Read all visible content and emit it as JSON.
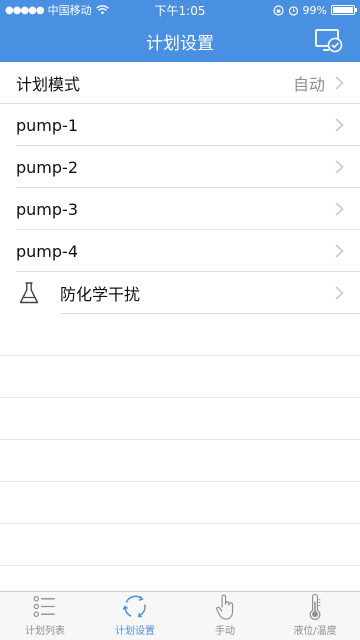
{
  "status_bar": {
    "carrier": "中国移动",
    "time": "下午1:05",
    "battery": "99%",
    "battery_level": 0.99
  },
  "nav": {
    "title": "计划设置",
    "action_icon": "screen-check-icon"
  },
  "list": {
    "mode": {
      "label": "计划模式",
      "value": "自动"
    },
    "pumps": [
      {
        "label": "pump-1"
      },
      {
        "label": "pump-2"
      },
      {
        "label": "pump-3"
      },
      {
        "label": "pump-4"
      }
    ],
    "chemical": {
      "label": "防化学干扰",
      "icon": "flask-icon"
    }
  },
  "tabs": [
    {
      "label": "计划列表",
      "icon": "list-icon",
      "active": false
    },
    {
      "label": "计划设置",
      "icon": "refresh-cycle-icon",
      "active": true
    },
    {
      "label": "手动",
      "icon": "hand-pointer-icon",
      "active": false
    },
    {
      "label": "液位/温度",
      "icon": "thermometer-icon",
      "active": false
    }
  ],
  "colors": {
    "primary": "#4a90e2",
    "separator": "#dedede",
    "secondary_text": "#8e8e93"
  }
}
